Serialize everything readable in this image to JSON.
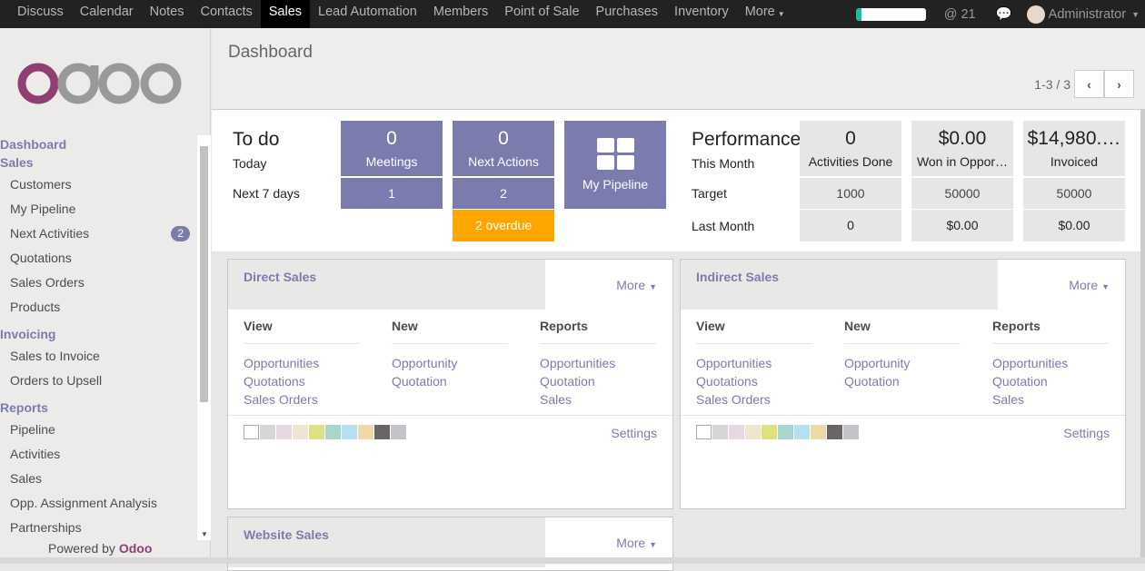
{
  "topbar": {
    "apps": [
      "Discuss",
      "Calendar",
      "Notes",
      "Contacts",
      "Sales",
      "Lead Automation",
      "Members",
      "Point of Sale",
      "Purchases",
      "Inventory",
      "More"
    ],
    "active": "Sales",
    "mentions": "@ 21",
    "user": "Administrator"
  },
  "sidebar": {
    "sections": [
      {
        "title": "Dashboard",
        "items": []
      },
      {
        "title": "Sales",
        "items": [
          {
            "label": "Customers"
          },
          {
            "label": "My Pipeline"
          },
          {
            "label": "Next Activities",
            "badge": "2"
          },
          {
            "label": "Quotations"
          },
          {
            "label": "Sales Orders"
          },
          {
            "label": "Products"
          }
        ]
      },
      {
        "title": "Invoicing",
        "items": [
          {
            "label": "Sales to Invoice"
          },
          {
            "label": "Orders to Upsell"
          }
        ]
      },
      {
        "title": "Reports",
        "items": [
          {
            "label": "Pipeline"
          },
          {
            "label": "Activities"
          },
          {
            "label": "Sales"
          },
          {
            "label": "Opp. Assignment Analysis"
          },
          {
            "label": "Partnerships"
          }
        ]
      }
    ],
    "powered": "Powered by",
    "powered_brand": "Odoo"
  },
  "header": {
    "title": "Dashboard",
    "pager": "1-3 / 3"
  },
  "todo": {
    "title": "To do",
    "today": "Today",
    "next7": "Next 7 days",
    "meetings": {
      "value": "0",
      "label": "Meetings",
      "next": "1"
    },
    "actions": {
      "value": "0",
      "label": "Next Actions",
      "next": "2",
      "overdue": "2 overdue"
    },
    "pipeline": "My Pipeline"
  },
  "performance": {
    "title": "Performance",
    "this_month": "This Month",
    "target": "Target",
    "last_month": "Last Month",
    "cols": [
      {
        "value": "0",
        "label": "Activities Done",
        "target": "1000",
        "last": "0"
      },
      {
        "value": "$0.00",
        "label": "Won in Oppor…",
        "target": "50000",
        "last": "$0.00"
      },
      {
        "value": "$14,980.…",
        "label": "Invoiced",
        "target": "50000",
        "last": "$0.00"
      }
    ]
  },
  "teams": [
    {
      "title": "Direct Sales",
      "more": "More",
      "view": "View",
      "new": "New",
      "reports": "Reports",
      "view_links": [
        "Opportunities",
        "Quotations",
        "Sales Orders"
      ],
      "new_links": [
        "Opportunity",
        "Quotation"
      ],
      "report_links": [
        "Opportunities",
        "Quotation",
        "Sales"
      ],
      "settings": "Settings"
    },
    {
      "title": "Indirect Sales",
      "more": "More",
      "view": "View",
      "new": "New",
      "reports": "Reports",
      "view_links": [
        "Opportunities",
        "Quotations",
        "Sales Orders"
      ],
      "new_links": [
        "Opportunity",
        "Quotation"
      ],
      "report_links": [
        "Opportunities",
        "Quotation",
        "Sales"
      ],
      "settings": "Settings"
    },
    {
      "title": "Website Sales",
      "more": "More"
    }
  ],
  "colors": {
    "accent": "#7c7bad",
    "overdue": "#ffa500",
    "swatches": [
      "#ffffff",
      "#d6d6d6",
      "#e6d8e3",
      "#ede7d2",
      "#dde182",
      "#a8d5ce",
      "#b5e1ee",
      "#efd9a9",
      "#6a6368",
      "#c5c3c7"
    ]
  }
}
